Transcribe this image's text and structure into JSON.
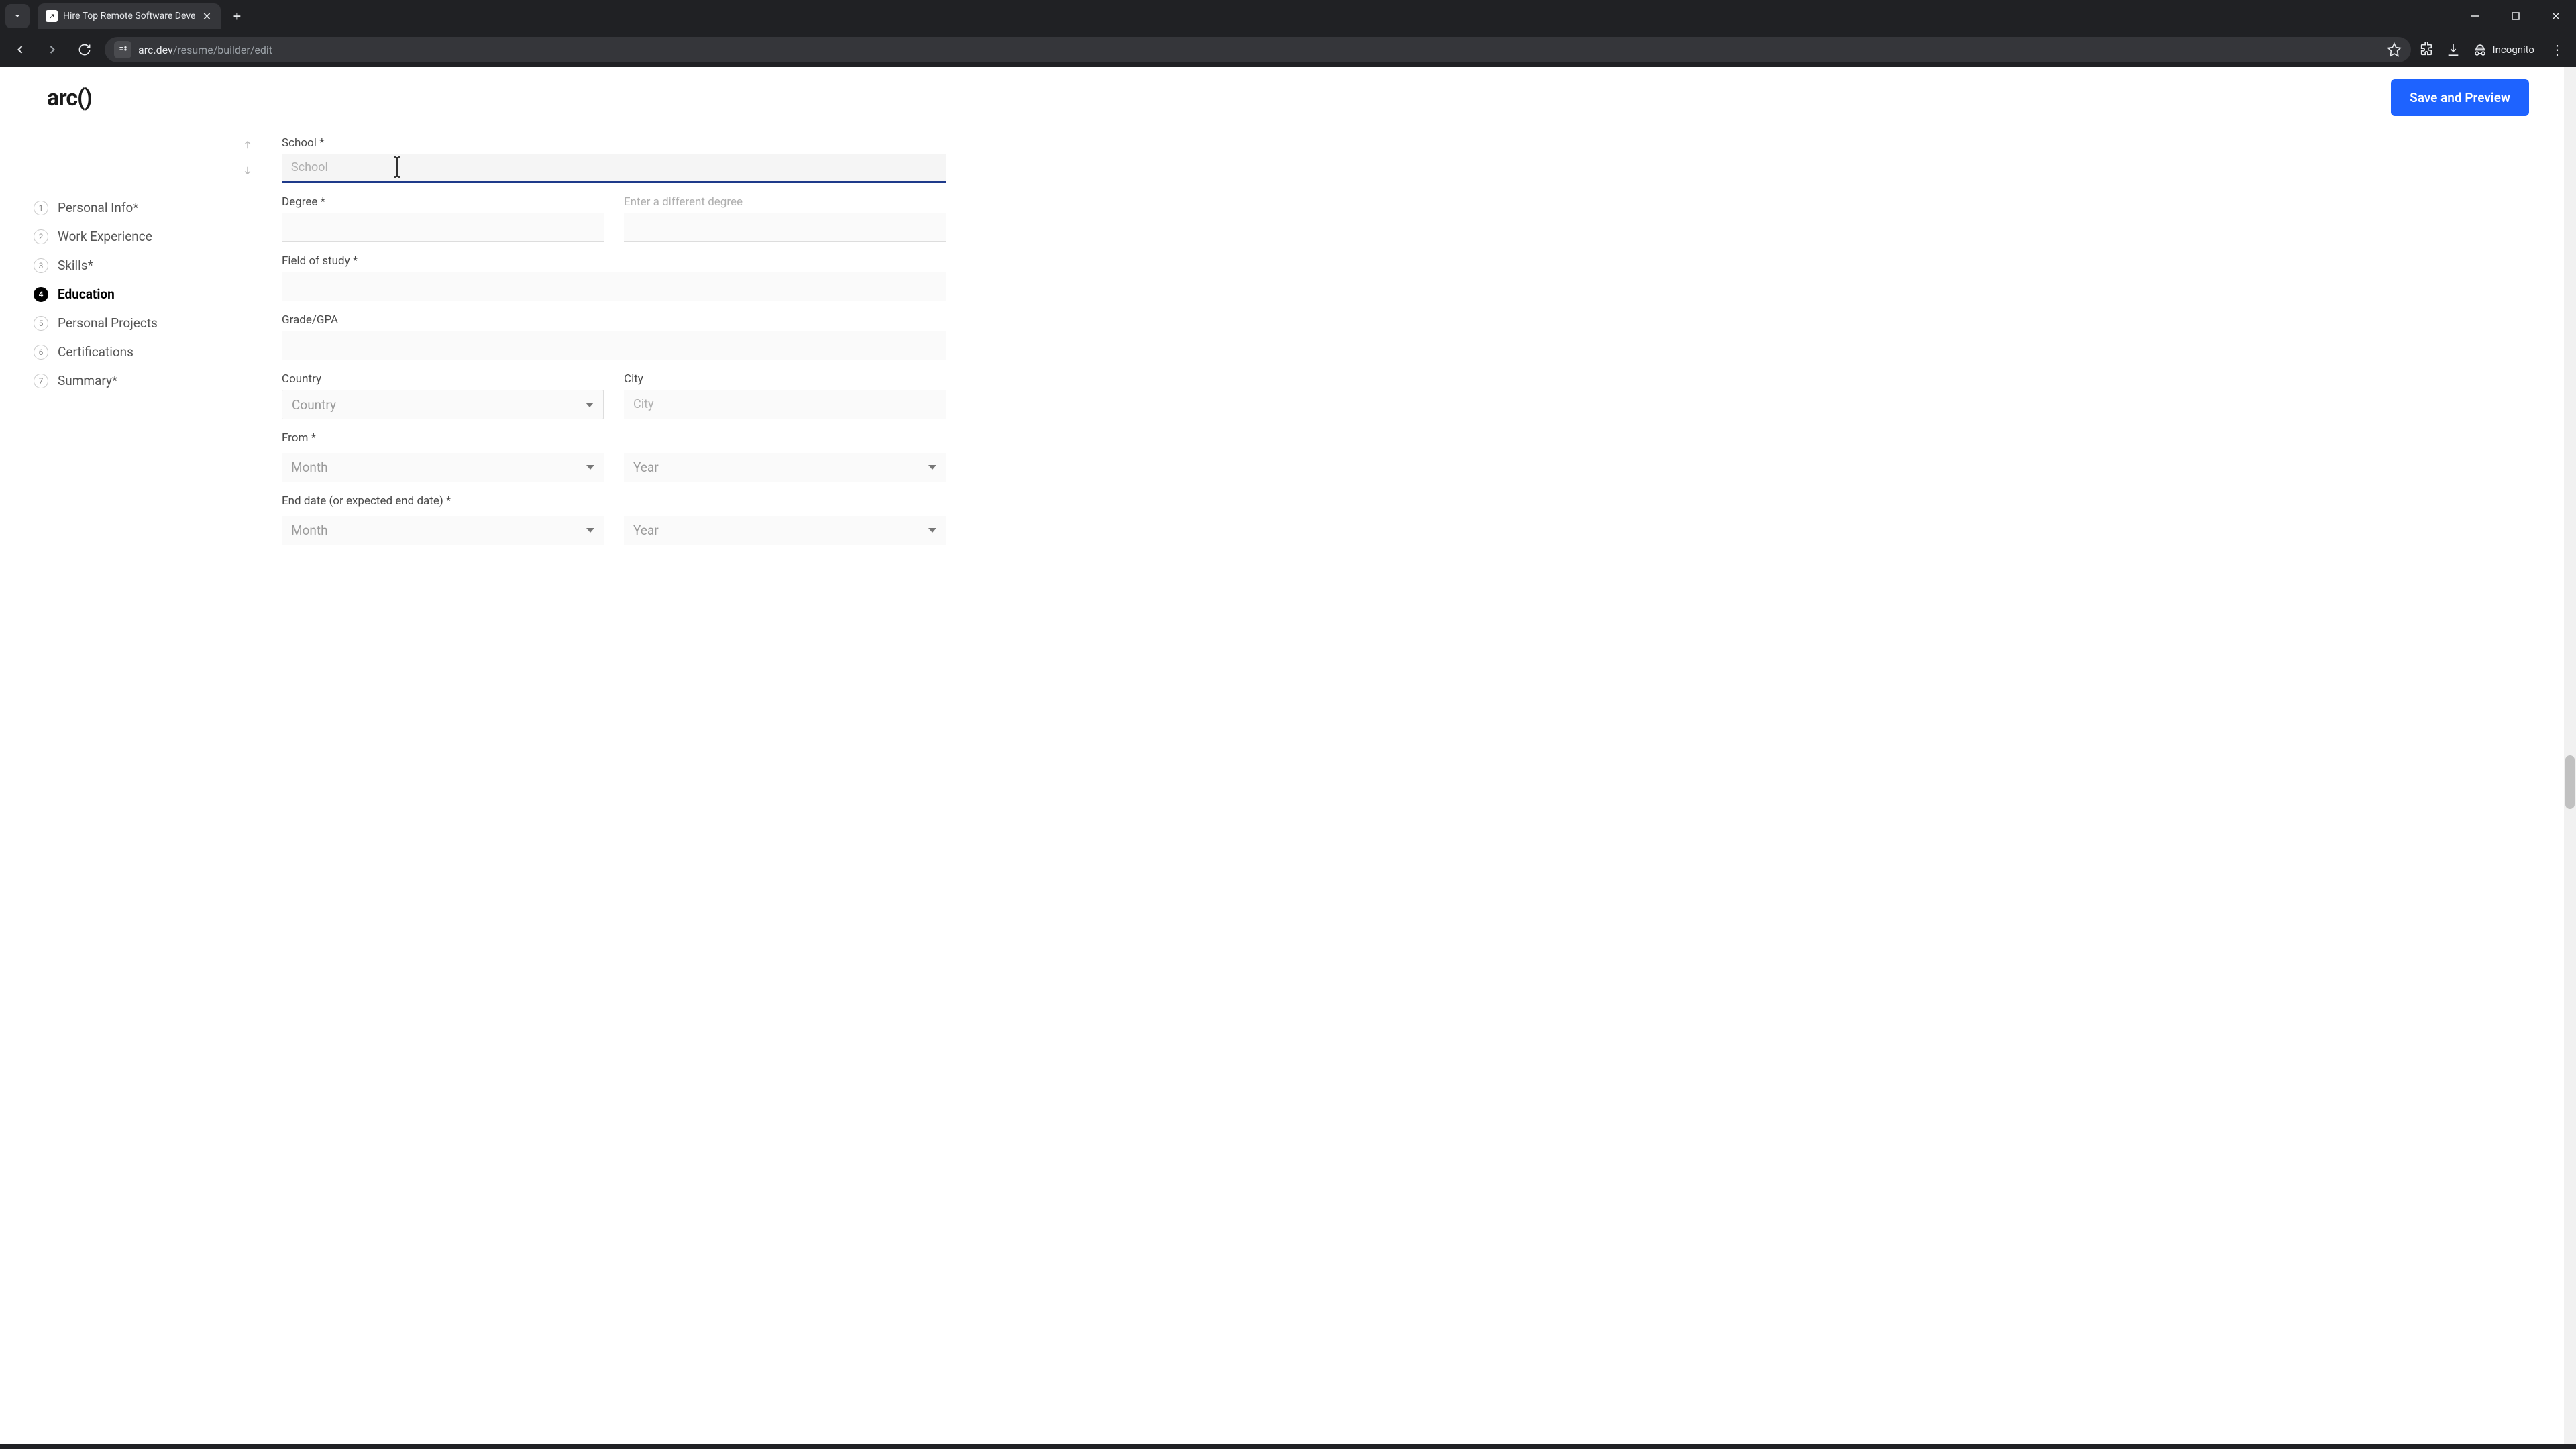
{
  "browser": {
    "tab_title": "Hire Top Remote Software Deve",
    "url_host": "arc.dev",
    "url_path": "/resume/builder/edit",
    "incognito_label": "Incognito"
  },
  "header": {
    "logo_text": "arc()",
    "save_preview_label": "Save and Preview"
  },
  "sidebar": {
    "items": [
      {
        "num": "1",
        "label": "Personal Info*"
      },
      {
        "num": "2",
        "label": "Work Experience"
      },
      {
        "num": "3",
        "label": "Skills*"
      },
      {
        "num": "4",
        "label": "Education"
      },
      {
        "num": "5",
        "label": "Personal Projects"
      },
      {
        "num": "6",
        "label": "Certifications"
      },
      {
        "num": "7",
        "label": "Summary*"
      }
    ],
    "active_index": 3
  },
  "form": {
    "school": {
      "label": "School *",
      "placeholder": "School",
      "value": ""
    },
    "degree": {
      "label": "Degree *",
      "value": ""
    },
    "other_degree": {
      "label": "Enter a different degree",
      "value": ""
    },
    "field_of_study": {
      "label": "Field of study *",
      "value": ""
    },
    "grade": {
      "label": "Grade/GPA",
      "value": ""
    },
    "country": {
      "label": "Country",
      "placeholder": "Country"
    },
    "city": {
      "label": "City",
      "placeholder": "City",
      "value": ""
    },
    "from": {
      "label": "From *",
      "month_placeholder": "Month",
      "year_placeholder": "Year"
    },
    "end": {
      "label": "End date (or expected end date) *",
      "month_placeholder": "Month",
      "year_placeholder": "Year"
    }
  }
}
